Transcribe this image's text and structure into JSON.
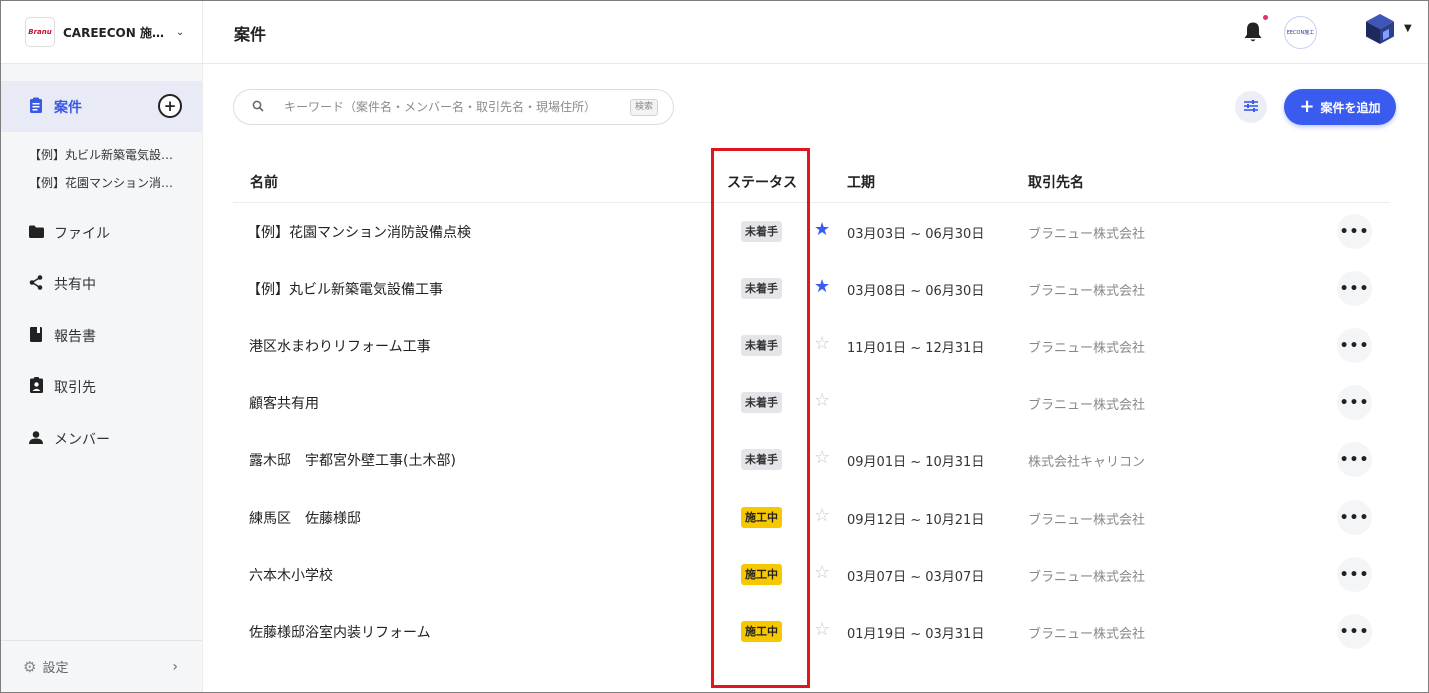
{
  "org": {
    "logo": "Branu",
    "name": "CAREECON 施…"
  },
  "sidebar": {
    "active": {
      "label": "案件",
      "icon": "clipboard-icon",
      "add_icon": "add-circle-icon"
    },
    "sub_items": [
      "【例】丸ビル新築電気設…",
      "【例】花園マンション消…"
    ],
    "items": [
      {
        "label": "ファイル",
        "icon": "folder-icon"
      },
      {
        "label": "共有中",
        "icon": "share-icon"
      },
      {
        "label": "報告書",
        "icon": "report-book-icon"
      },
      {
        "label": "取引先",
        "icon": "contact-badge-icon"
      },
      {
        "label": "メンバー",
        "icon": "person-icon"
      }
    ],
    "settings": {
      "label": "設定",
      "icon": "gear-icon"
    }
  },
  "header": {
    "title": "案件",
    "avatar_text": "EECON施工"
  },
  "search": {
    "placeholder": "キーワード（案件名・メンバー名・取引先名・現場住所）",
    "value": "",
    "shortcut": "検索"
  },
  "toolbar": {
    "add_label": "案件を追加"
  },
  "table": {
    "columns": {
      "name": "名前",
      "status": "ステータス",
      "period": "工期",
      "client": "取引先名"
    },
    "rows": [
      {
        "name": "【例】花園マンション消防設備点検",
        "status": "未着手",
        "status_type": "pending",
        "starred": true,
        "period": "03月03日 ~ 06月30日",
        "client": "ブラニュー株式会社"
      },
      {
        "name": "【例】丸ビル新築電気設備工事",
        "status": "未着手",
        "status_type": "pending",
        "starred": true,
        "period": "03月08日 ~ 06月30日",
        "client": "ブラニュー株式会社"
      },
      {
        "name": "港区水まわりリフォーム工事",
        "status": "未着手",
        "status_type": "pending",
        "starred": false,
        "period": "11月01日 ~ 12月31日",
        "client": "ブラニュー株式会社"
      },
      {
        "name": "顧客共有用",
        "status": "未着手",
        "status_type": "pending",
        "starred": false,
        "period": "",
        "client": "ブラニュー株式会社"
      },
      {
        "name": "露木邸　宇都宮外壁工事(土木部)",
        "status": "未着手",
        "status_type": "pending",
        "starred": false,
        "period": "09月01日 ~ 10月31日",
        "client": "株式会社キャリコン"
      },
      {
        "name": "練馬区　佐藤様邸",
        "status": "施工中",
        "status_type": "active",
        "starred": false,
        "period": "09月12日 ~ 10月21日",
        "client": "ブラニュー株式会社"
      },
      {
        "name": "六本木小学校",
        "status": "施工中",
        "status_type": "active",
        "starred": false,
        "period": "03月07日 ~ 03月07日",
        "client": "ブラニュー株式会社"
      },
      {
        "name": "佐藤様邸浴室内装リフォーム",
        "status": "施工中",
        "status_type": "active",
        "starred": false,
        "period": "01月19日 ~ 03月31日",
        "client": "ブラニュー株式会社"
      }
    ]
  },
  "colors": {
    "accent": "#3a5bf0",
    "highlight": "#e0151d",
    "badge_pending": "#e4e5e9",
    "badge_active": "#f7c800"
  }
}
